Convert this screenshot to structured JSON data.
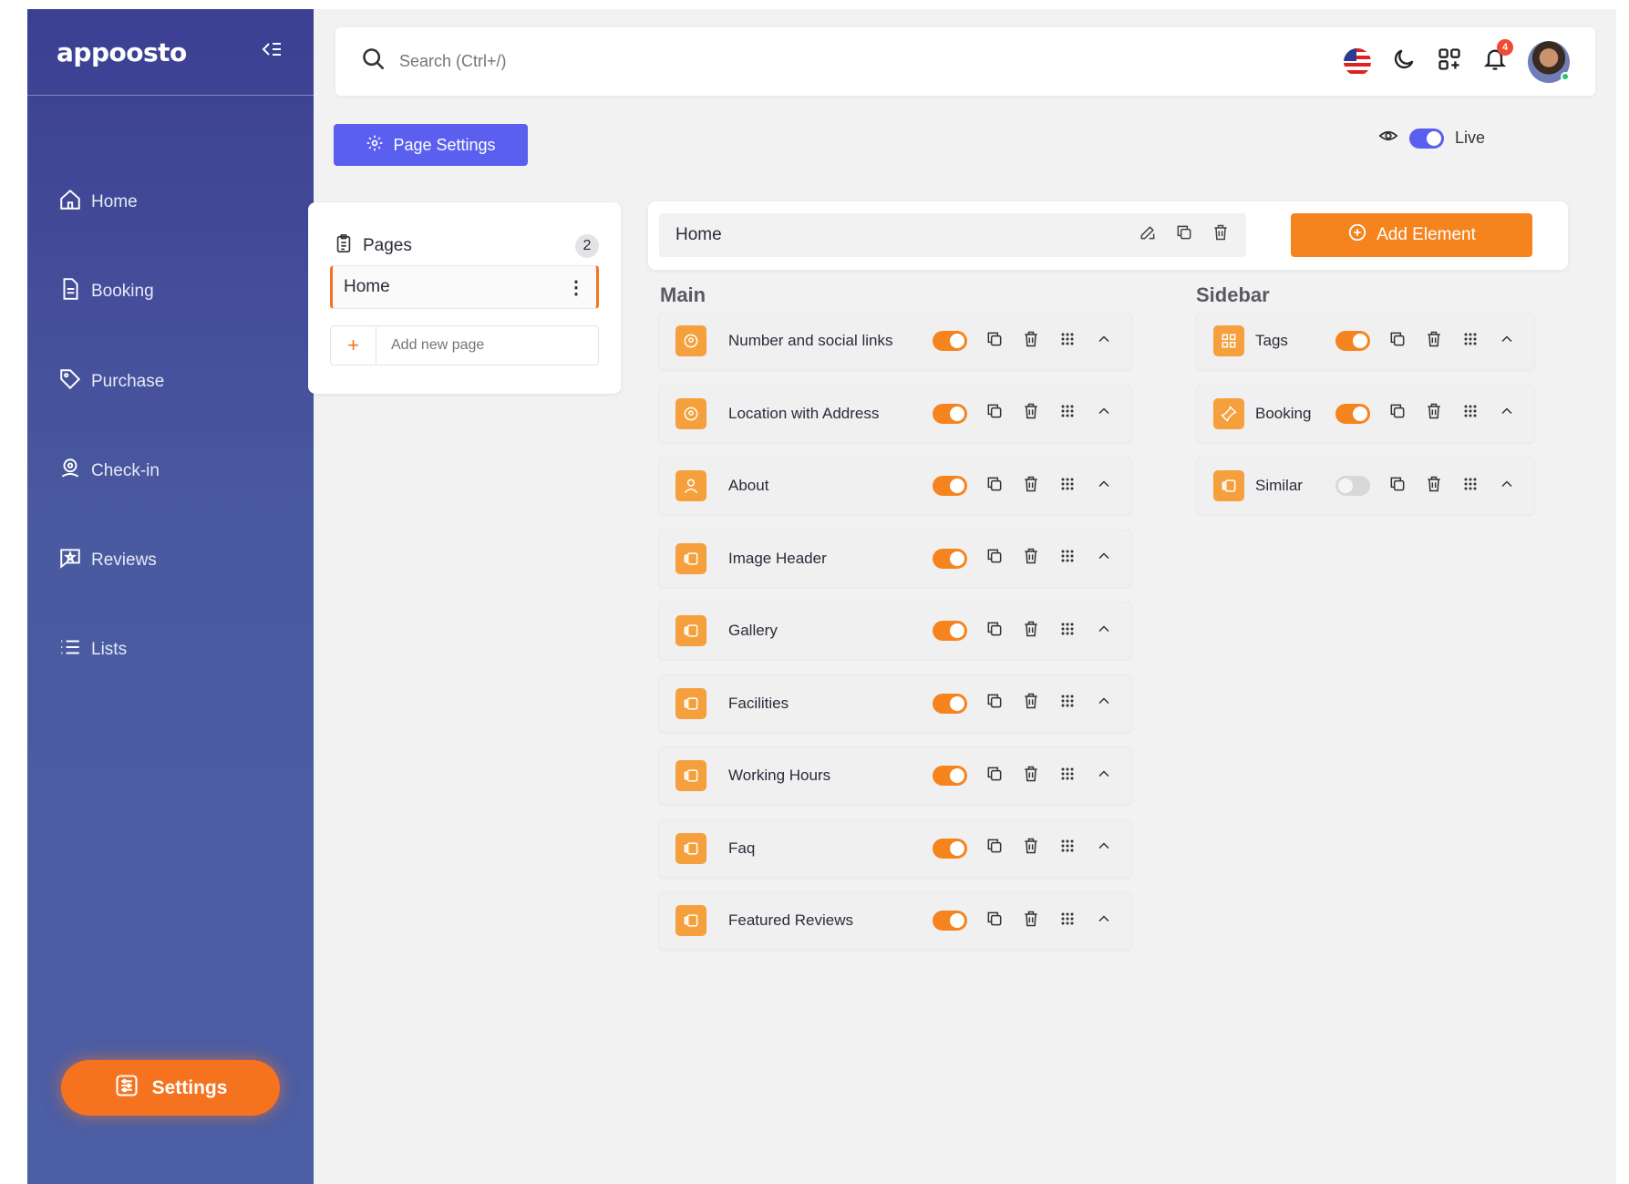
{
  "brand": {
    "logo_text": "appoosto",
    "tagline": ""
  },
  "sidebar": {
    "items": [
      {
        "label": "Home",
        "icon": "home-icon"
      },
      {
        "label": "Booking",
        "icon": "document-icon"
      },
      {
        "label": "Purchase",
        "icon": "tag-icon"
      },
      {
        "label": "Check-in",
        "icon": "location-pin-icon"
      },
      {
        "label": "Reviews",
        "icon": "star-chat-icon"
      },
      {
        "label": "Lists",
        "icon": "list-icon"
      }
    ],
    "settings_label": "Settings"
  },
  "topbar": {
    "search_placeholder": "Search (Ctrl+/)",
    "notification_count": "4"
  },
  "page_settings_label": "Page Settings",
  "live_label": "Live",
  "pages_panel": {
    "title": "Pages",
    "count": "2",
    "current_page": "Home",
    "add_placeholder": "Add new page",
    "add_symbol": "+"
  },
  "page_header": {
    "page_name": "Home",
    "add_element_label": "Add Element"
  },
  "main_section": {
    "title": "Main",
    "elements": [
      {
        "label": "Number and social links",
        "enabled": true,
        "icon": "location-icon"
      },
      {
        "label": "Location with Address",
        "enabled": true,
        "icon": "location-icon"
      },
      {
        "label": "About",
        "enabled": true,
        "icon": "user-icon"
      },
      {
        "label": "Image Header",
        "enabled": true,
        "icon": "block-icon"
      },
      {
        "label": "Gallery",
        "enabled": true,
        "icon": "block-icon"
      },
      {
        "label": "Facilities",
        "enabled": true,
        "icon": "block-icon"
      },
      {
        "label": "Working Hours",
        "enabled": true,
        "icon": "block-icon"
      },
      {
        "label": "Faq",
        "enabled": true,
        "icon": "block-icon"
      },
      {
        "label": "Featured Reviews",
        "enabled": true,
        "icon": "block-icon"
      }
    ]
  },
  "sidebar_section": {
    "title": "Sidebar",
    "elements": [
      {
        "label": "Tags",
        "enabled": true,
        "icon": "grid-icon"
      },
      {
        "label": "Booking",
        "enabled": true,
        "icon": "pin-icon"
      },
      {
        "label": "Similar",
        "enabled": false,
        "icon": "block-icon"
      }
    ]
  },
  "colors": {
    "accent_orange": "#f5841f",
    "accent_blue": "#5b5fef",
    "sidebar_top": "#3c3f92",
    "sidebar_bottom": "#4c5ea4"
  }
}
